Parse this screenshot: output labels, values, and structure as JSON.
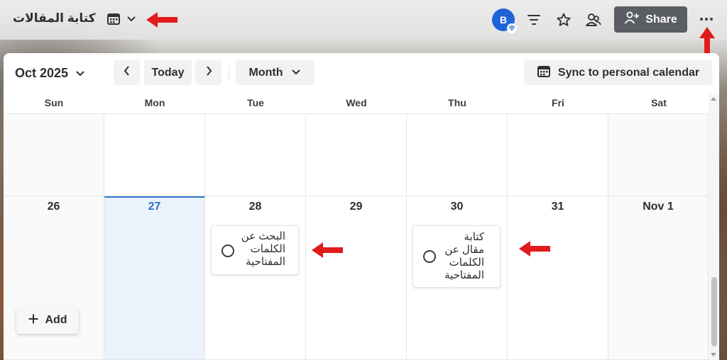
{
  "app": {
    "title": "كتابة المقالات"
  },
  "topbar": {
    "view_icon": "calendar-icon",
    "avatar_initial": "B",
    "share_label": "Share",
    "icons": [
      "filter-icon",
      "star-icon",
      "people-icon",
      "more-icon"
    ]
  },
  "toolbar": {
    "month_label": "Oct 2025",
    "today_label": "Today",
    "view_label": "Month",
    "sync_label": "Sync to personal calendar"
  },
  "weekdays": [
    "Sun",
    "Mon",
    "Tue",
    "Wed",
    "Thu",
    "Fri",
    "Sat"
  ],
  "week2": {
    "days": [
      "26",
      "27",
      "28",
      "29",
      "30",
      "31",
      "Nov 1"
    ],
    "today": "27"
  },
  "events": [
    {
      "day": "28",
      "title": "البحث عن الكلمات المفتاحية",
      "lines": [
        "البحث عن",
        "الكلمات",
        "المفتاحية"
      ]
    },
    {
      "day": "30",
      "title": "كتابة مقال عن الكلمات المفتاحية",
      "lines": [
        "كتابة",
        "مقال عن",
        "الكلمات",
        "المفتاحية"
      ]
    }
  ],
  "add_label": "Add",
  "colors": {
    "accent": "#2e6fc2",
    "today_bg": "#eaf2fc",
    "share_bg": "#5a5d61",
    "annotation_arrow": "#e01b1b"
  }
}
